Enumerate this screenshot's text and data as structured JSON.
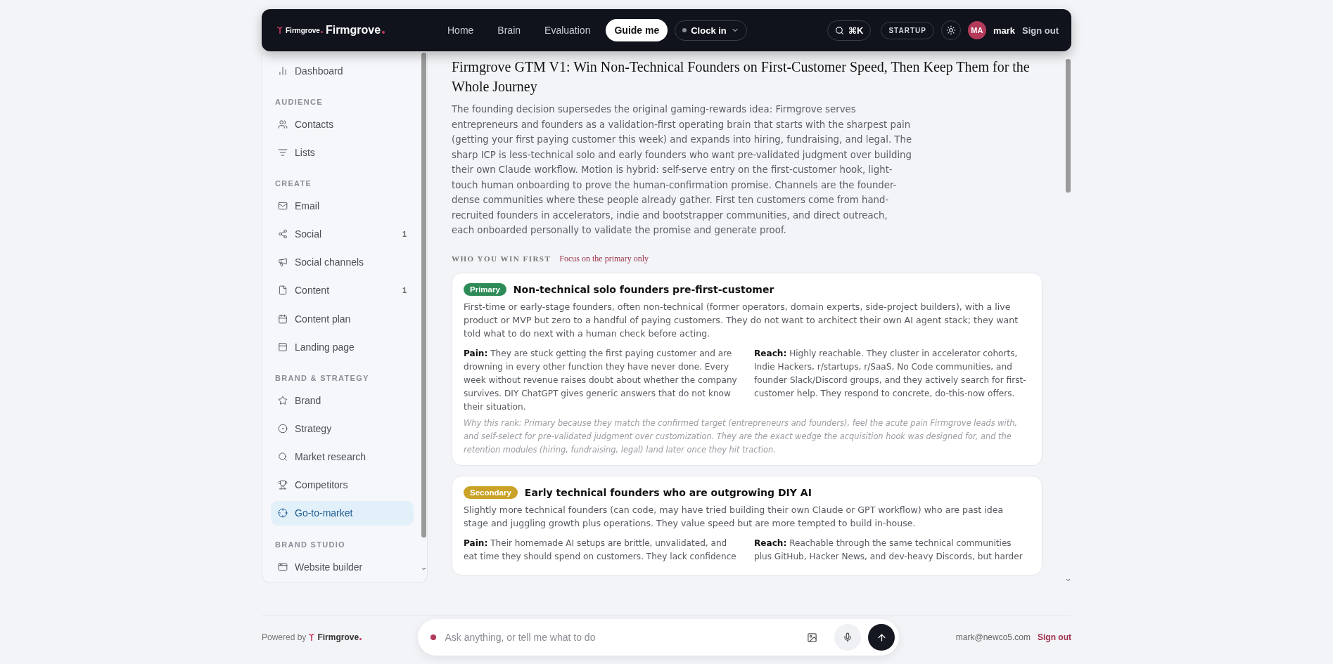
{
  "header": {
    "logo_small": "Firmgrove",
    "logo": "Firmgrove",
    "nav": [
      {
        "label": "Home",
        "selected": false
      },
      {
        "label": "Brain",
        "selected": false
      },
      {
        "label": "Evaluation",
        "selected": false
      },
      {
        "label": "Guide me",
        "selected": true
      }
    ],
    "clock_in": "Clock in",
    "shortcut": "⌘K",
    "plan": "STARTUP",
    "avatar": "MA",
    "user": "mark",
    "sign_out": "Sign out"
  },
  "sidebar": {
    "sections": [
      {
        "items": [
          {
            "label": "Dashboard",
            "selected": false
          }
        ]
      },
      {
        "title": "AUDIENCE",
        "items": [
          {
            "label": "Contacts",
            "selected": false
          },
          {
            "label": "Lists",
            "selected": false
          }
        ]
      },
      {
        "title": "CREATE",
        "items": [
          {
            "label": "Email",
            "selected": false
          },
          {
            "label": "Social",
            "badge": "1",
            "selected": false
          },
          {
            "label": "Social channels",
            "selected": false
          },
          {
            "label": "Content",
            "badge": "1",
            "selected": false
          },
          {
            "label": "Content plan",
            "selected": false
          },
          {
            "label": "Landing page",
            "selected": false
          }
        ]
      },
      {
        "title": "BRAND & STRATEGY",
        "items": [
          {
            "label": "Brand",
            "selected": false
          },
          {
            "label": "Strategy",
            "selected": false
          },
          {
            "label": "Market research",
            "selected": false
          },
          {
            "label": "Competitors",
            "selected": false
          },
          {
            "label": "Go-to-market",
            "selected": true
          }
        ]
      },
      {
        "title": "BRAND STUDIO",
        "items": [
          {
            "label": "Website builder",
            "selected": false
          }
        ]
      }
    ]
  },
  "main": {
    "title": "Firmgrove GTM V1: Win Non-Technical Founders on First-Customer Speed, Then Keep Them for the Whole Journey",
    "summary": "The founding decision supersedes the original gaming-rewards idea: Firmgrove serves entrepreneurs and founders as a validation-first operating brain that starts with the sharpest pain (getting your first paying customer this week) and expands into hiring, fundraising, and legal. The sharp ICP is less-technical solo and early founders who want pre-validated judgment over building their own Claude workflow. Motion is hybrid: self-serve entry on the first-customer hook, light-touch human onboarding to prove the human-confirmation promise. Channels are the founder-dense communities where these people already gather. First ten customers come from hand-recruited founders in accelerators, indie and bootstrapper communities, and direct outreach, each onboarded personally to validate the promise and generate proof.",
    "section_label": "WHO YOU WIN FIRST",
    "section_note": "Focus on the primary only",
    "segments": [
      {
        "tier": "Primary",
        "color": "#2e8b57",
        "title": "Non-technical solo founders pre-first-customer",
        "description": "First-time or early-stage founders, often non-technical (former operators, domain experts, side-project builders), with a live product or MVP but zero to a handful of paying customers. They do not want to architect their own AI agent stack; they want told what to do next with a human check before acting.",
        "pain": "**Pain:** They are stuck getting the first paying customer and are drowning in every other function they have never done. Every week without revenue raises doubt about whether the company survives. DIY ChatGPT gives generic answers that do not know their situation.",
        "reach": "**Reach:** Highly reachable. They cluster in accelerator cohorts, Indie Hackers, r/startups, r/SaaS, No Code communities, and founder Slack/Discord groups, and they actively search for first-customer help. They respond to concrete, do-this-now offers.",
        "rationale": "Why this rank: Primary because they match the confirmed target (entrepreneurs and founders), feel the acute pain Firmgrove leads with, and self-select for pre-validated judgment over customization. They are the exact wedge the acquisition hook was designed for, and the retention modules (hiring, fundraising, legal) land later once they hit traction."
      },
      {
        "tier": "Secondary",
        "color": "#c9a227",
        "title": "Early technical founders who are outgrowing DIY AI",
        "description": "Slightly more technical founders (can code, may have tried building their own Claude or GPT workflow) who are past idea stage and juggling growth plus operations. They value speed but are more tempted to build in-house.",
        "pain": "**Pain:** Their homemade AI setups are brittle, unvalidated, and eat time they should spend on customers. They lack confidence",
        "reach": "**Reach:** Reachable through the same technical communities plus GitHub, Hacker News, and dev-heavy Discords, but harder"
      }
    ]
  },
  "footer": {
    "powered_by": "Powered by",
    "brand": "Firmgrove",
    "placeholder": "Ask anything, or tell me what to do",
    "email": "mark@newco5.com",
    "sign_out": "Sign out"
  }
}
